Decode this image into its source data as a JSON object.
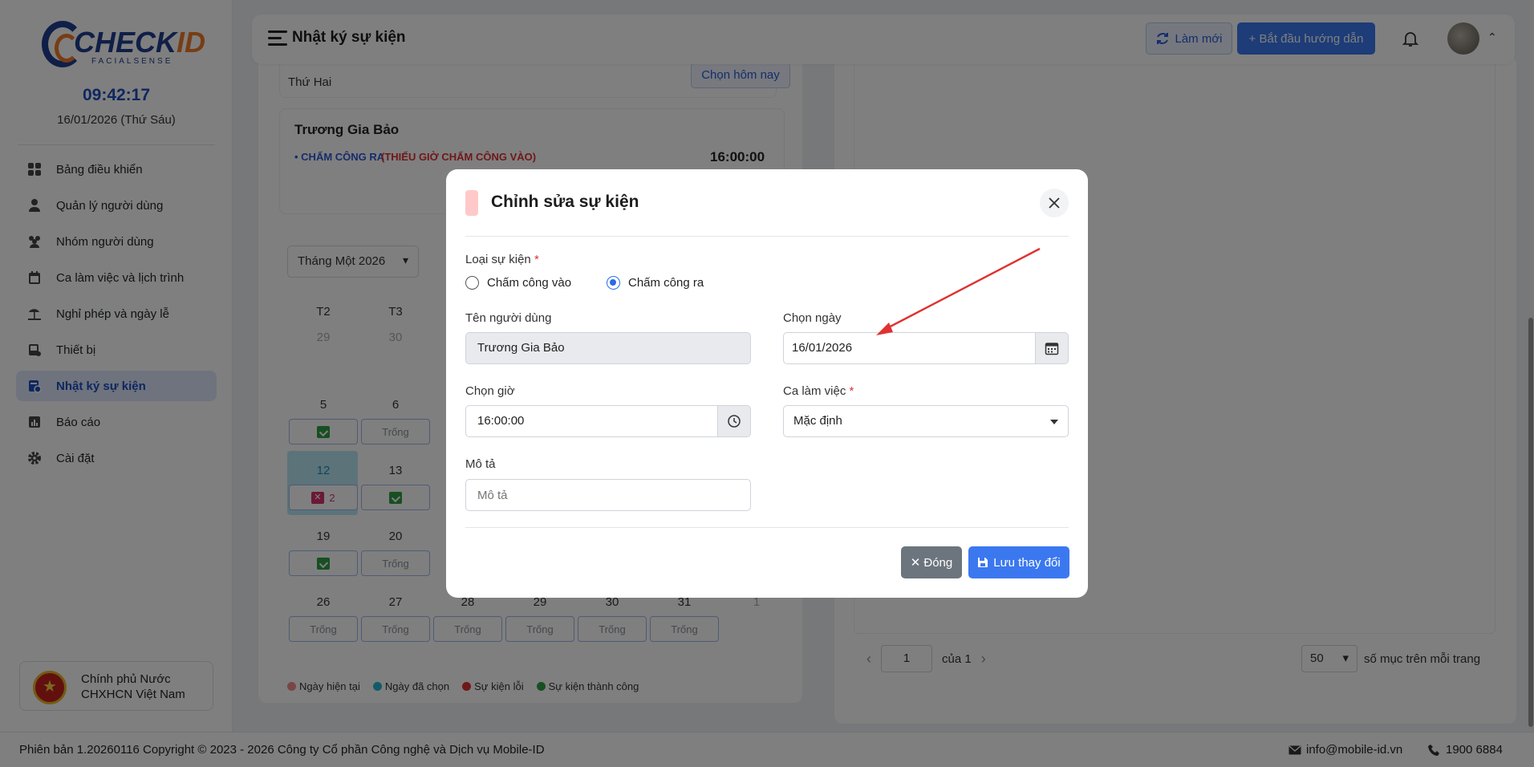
{
  "sidebar": {
    "logo_main": "CHECK",
    "logo_accent": "ID",
    "logo_sub": "FACIALSENSE",
    "clock": "09:42:17",
    "date": "16/01/2026 (Thứ Sáu)",
    "items": [
      {
        "label": "Bảng điều khiển",
        "icon": "dashboard-icon"
      },
      {
        "label": "Quản lý người dùng",
        "icon": "user-icon"
      },
      {
        "label": "Nhóm người dùng",
        "icon": "users-group-icon"
      },
      {
        "label": "Ca làm việc và lịch trình",
        "icon": "calendar-icon"
      },
      {
        "label": "Nghỉ phép và ngày lễ",
        "icon": "beach-icon"
      },
      {
        "label": "Thiết bị",
        "icon": "device-icon"
      },
      {
        "label": "Nhật ký sự kiện",
        "icon": "event-log-icon",
        "active": true
      },
      {
        "label": "Báo cáo",
        "icon": "report-icon"
      },
      {
        "label": "Cài đặt",
        "icon": "gear-icon"
      }
    ],
    "gov_text_line1": "Chính phủ Nước",
    "gov_text_line2": "CHXHCN Việt Nam"
  },
  "header": {
    "title": "Nhật ký sự kiện",
    "refresh_label": "Làm mới",
    "guide_label": "+ Bắt đầu hướng dẫn"
  },
  "left_panel": {
    "weekday": "Thứ Hai",
    "today_button": "Chọn hôm nay",
    "event": {
      "name": "Trương Gia Bảo",
      "type": "• CHẤM CÔNG RA",
      "warning": "(THIẾU GIỜ CHẤM CÔNG VÀO)",
      "time": "16:00:00"
    },
    "month_select": "Tháng Một 2026",
    "weekday_headers": [
      "T2",
      "T3"
    ],
    "calendar": {
      "row0": [
        "29",
        "30"
      ],
      "row1": [
        "5",
        "6"
      ],
      "row2": [
        "12",
        "13"
      ],
      "row3": [
        "19",
        "20"
      ],
      "row4": [
        "26",
        "27",
        "28",
        "29",
        "30",
        "31",
        "1"
      ],
      "empty_label": "Trống",
      "error_count": "2"
    },
    "legend": [
      {
        "label": "Ngày hiện tại",
        "color": "#f08c8c"
      },
      {
        "label": "Ngày đã chọn",
        "color": "#22b8cf"
      },
      {
        "label": "Sự kiện lỗi",
        "color": "#e03131"
      },
      {
        "label": "Sự kiện thành công",
        "color": "#2f9e44"
      }
    ]
  },
  "right_panel": {
    "page": "1",
    "page_of": "của 1",
    "per_page": "50",
    "per_page_label": "số mục trên mỗi trang"
  },
  "footer": {
    "copyright": "Phiên bản 1.20260116 Copyright © 2023 - 2026 Công ty Cổ phần Công nghệ và Dịch vụ Mobile-ID",
    "email": "info@mobile-id.vn",
    "phone": "1900 6884"
  },
  "modal": {
    "title": "Chỉnh sửa sự kiện",
    "event_type_label": "Loại sự kiện",
    "radio_in": "Chấm công vào",
    "radio_out": "Chấm công ra",
    "selected_type": "Chấm công ra",
    "username_label": "Tên người dùng",
    "username_value": "Trương Gia Bảo",
    "date_label": "Chọn ngày",
    "date_value": "16/01/2026",
    "time_label": "Chọn giờ",
    "time_value": "16:00:00",
    "shift_label": "Ca làm việc",
    "shift_value": "Mặc định",
    "desc_label": "Mô tả",
    "desc_placeholder": "Mô tả",
    "close_button": "Đóng",
    "save_button": "Lưu thay đổi",
    "required_mark": "*"
  },
  "colors": {
    "primary": "#3b78f0",
    "brand_blue": "#1f3f8f",
    "brand_orange": "#f07a28",
    "annotation_arrow": "#e03131"
  }
}
